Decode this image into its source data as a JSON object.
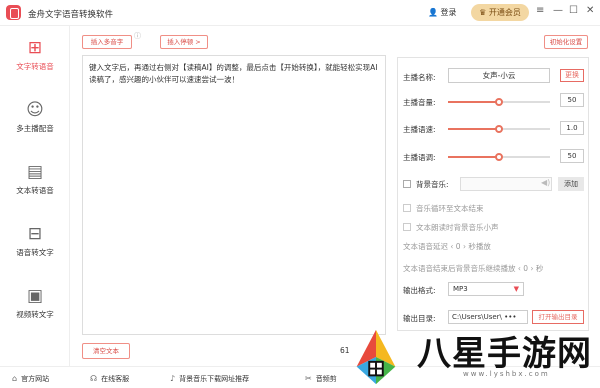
{
  "app": {
    "title": "金舟文字语音转换软件",
    "login": "登录",
    "vip": "开通会员"
  },
  "sidebar": {
    "items": [
      {
        "label": "文字转语音",
        "icon": "text-to-speech-icon"
      },
      {
        "label": "多主播配音",
        "icon": "user-add-icon"
      },
      {
        "label": "文本转语音",
        "icon": "document-icon"
      },
      {
        "label": "语音转文字",
        "icon": "voice-to-text-icon"
      },
      {
        "label": "视频转文字",
        "icon": "video-to-text-icon"
      }
    ]
  },
  "toolbar": {
    "insert_phonetic": "插入多音字",
    "insert_pause": "插入停顿 >",
    "init_settings": "初始化设置"
  },
  "editor": {
    "text": "键入文字后，再通过右侧对【读稿AI】的调整，最后点击【开始转换】，就能轻松实现AI读稿了，感兴趣的小伙伴可以速速尝试一波！",
    "clear": "清空文本",
    "count_prefix": "61"
  },
  "settings": {
    "anchor_name_label": "主播名称:",
    "anchor_name": "女声-小云",
    "switch": "更换",
    "volume_label": "主播音量:",
    "volume": "50",
    "speed_label": "主播语速:",
    "speed": "1.0",
    "pitch_label": "主播语调:",
    "pitch": "50",
    "bgm_label": "背景音乐:",
    "add": "添加",
    "loop_label": "音乐循环至文本结束",
    "duck_label": "文本朗读时背景音乐小声",
    "delay_label": "文本语音延迟",
    "delay_value": "0",
    "delay_unit": "秒播放",
    "after_label": "文本语音结束后背景音乐继续播放",
    "after_value": "0",
    "after_unit": "秒",
    "format_label": "输出格式:",
    "format": "MP3",
    "dir_label": "输出目录:",
    "dir": "C:\\Users\\User\\",
    "dir_more": "•••",
    "open_dir": "打开输出目录"
  },
  "levels": {
    "volume": 0.5,
    "speed": 0.5,
    "pitch": 0.5
  },
  "footer": {
    "items": [
      "官方网站",
      "在线客服",
      "背景音乐下载网址推荐",
      "音频剪"
    ]
  },
  "watermark": {
    "title": "八星手游网",
    "url": "www.lyshbx.com"
  }
}
